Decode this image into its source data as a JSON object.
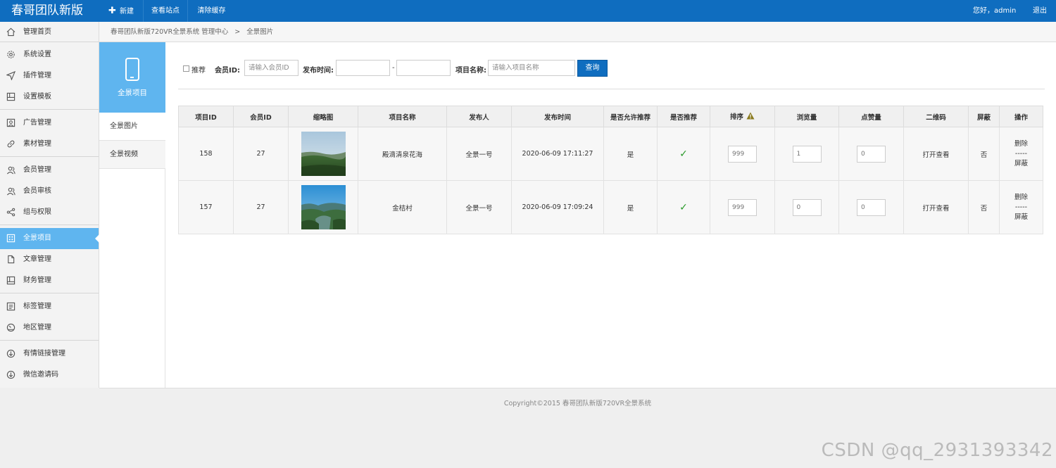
{
  "header": {
    "brand": "春哥团队新版",
    "new_label": "新建",
    "view_site_label": "查看站点",
    "clear_cache_label": "清除缓存",
    "greeting": "您好，admin",
    "logout_label": "退出"
  },
  "sidebar": {
    "items": [
      {
        "label": "管理首页",
        "icon": "home-icon"
      },
      {
        "label": "系统设置",
        "icon": "gear-icon"
      },
      {
        "label": "插件管理",
        "icon": "send-icon"
      },
      {
        "label": "设置模板",
        "icon": "template-icon"
      },
      {
        "label": "广告管理",
        "icon": "image-icon"
      },
      {
        "label": "素材管理",
        "icon": "link-icon"
      },
      {
        "label": "会员管理",
        "icon": "users-icon"
      },
      {
        "label": "会员审核",
        "icon": "user-check-icon"
      },
      {
        "label": "组与权限",
        "icon": "share-icon"
      },
      {
        "label": "全景项目",
        "icon": "grid-icon"
      },
      {
        "label": "文章管理",
        "icon": "file-icon"
      },
      {
        "label": "财务管理",
        "icon": "ledger-icon"
      },
      {
        "label": "标签管理",
        "icon": "list-icon"
      },
      {
        "label": "地区管理",
        "icon": "dashboard-icon"
      },
      {
        "label": "有情链接管理",
        "icon": "arrow-circle-icon"
      },
      {
        "label": "微信邀请码",
        "icon": "arrow-circle-icon"
      }
    ]
  },
  "breadcrumb": {
    "root": "春哥团队新版720VR全景系统 管理中心",
    "separator": ">",
    "current": "全景图片"
  },
  "submenu": {
    "title": "全景项目",
    "items": [
      "全景图片",
      "全景视频"
    ]
  },
  "filter": {
    "recommend_label": "推荐",
    "member_id_label": "会员ID:",
    "member_id_placeholder": "请输入会员ID",
    "publish_time_label": "发布时间:",
    "dash": "-",
    "project_name_label": "项目名称:",
    "project_name_placeholder": "请输入项目名称",
    "query_button": "查询"
  },
  "table": {
    "headers": [
      "项目ID",
      "会员ID",
      "缩略图",
      "项目名称",
      "发布人",
      "发布时间",
      "是否允许推荐",
      "是否推荐",
      "排序",
      "浏览量",
      "点赞量",
      "二维码",
      "屏蔽",
      "操作"
    ],
    "rows": [
      {
        "id": "158",
        "member_id": "27",
        "name": "殿滴清泉花海",
        "publisher": "全景一号",
        "time": "2020-06-09 17:11:27",
        "allow_recommend": "是",
        "recommended": "✓",
        "sort": "999",
        "views": "1",
        "likes": "0",
        "qrcode": "打开查看",
        "blocked": "否",
        "op_delete": "删除",
        "op_sep": "-----",
        "op_block": "屏蔽"
      },
      {
        "id": "157",
        "member_id": "27",
        "name": "金桔村",
        "publisher": "全景一号",
        "time": "2020-06-09 17:09:24",
        "allow_recommend": "是",
        "recommended": "✓",
        "sort": "999",
        "views": "0",
        "likes": "0",
        "qrcode": "打开查看",
        "blocked": "否",
        "op_delete": "删除",
        "op_sep": "-----",
        "op_block": "屏蔽"
      }
    ]
  },
  "footer": {
    "copyright": "Copyright©2015    春哥团队新版720VR全景系统"
  },
  "watermark": "CSDN @qq_2931393342",
  "colors": {
    "header_bg": "#0f6dbf",
    "active_blue": "#5fb5ef",
    "check_green": "#2a9a2a"
  }
}
